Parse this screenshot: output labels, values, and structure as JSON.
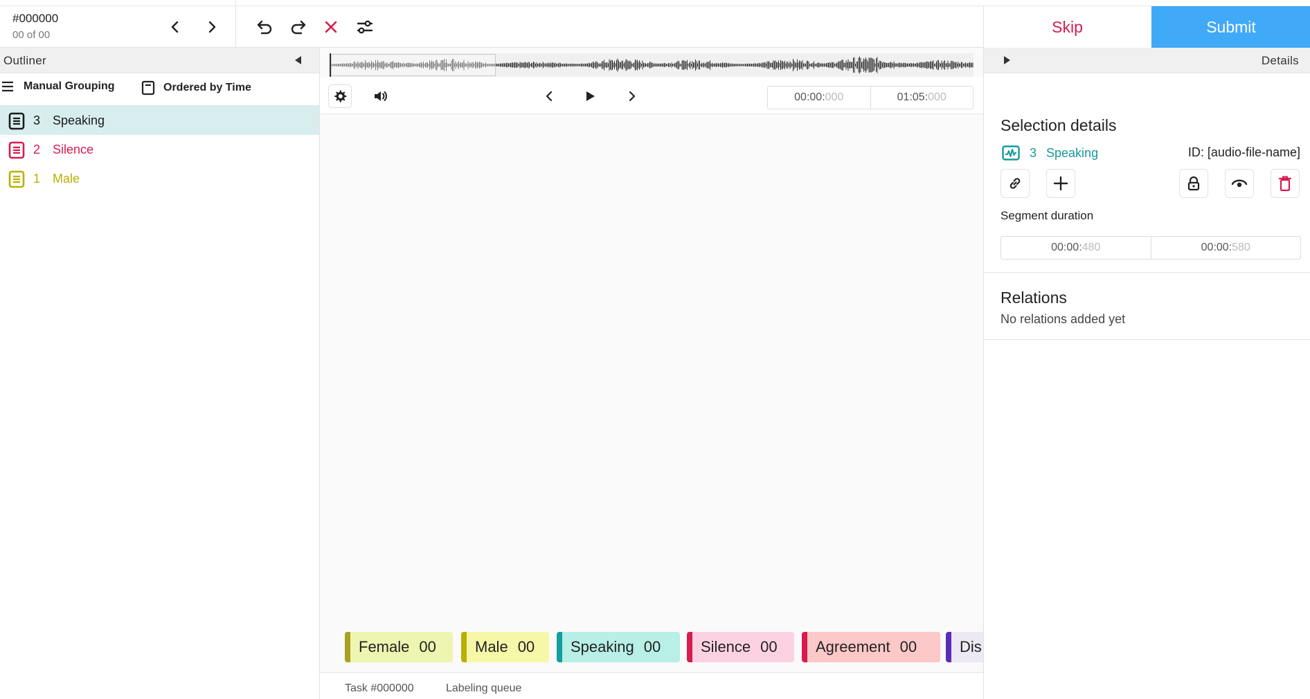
{
  "header": {
    "task_id": "#000000",
    "task_count": "00 of 00",
    "icons": [
      "chevron-left-icon",
      "chevron-right-icon",
      "undo-icon",
      "redo-icon",
      "close-icon",
      "settings-sliders-icon"
    ]
  },
  "actions": {
    "skip_label": "Skip",
    "submit_label": "Submit"
  },
  "outliner": {
    "title": "Outliner",
    "grouping_label": "Manual Grouping",
    "ordering_label": "Ordered by Time",
    "regions": [
      {
        "number": "3",
        "label": "Speaking",
        "color": "#1a1a1a",
        "selected": true
      },
      {
        "number": "2",
        "label": "Silence",
        "color": "#d81b4f",
        "selected": false
      },
      {
        "number": "1",
        "label": "Male",
        "color": "#b8b000",
        "selected": false
      }
    ]
  },
  "player": {
    "current_time_main": "00:00:",
    "current_time_ms": "000",
    "duration_main": "01:05:",
    "duration_ms": "000"
  },
  "labels": [
    {
      "name": "Female",
      "count": "00",
      "bg": "#eef5b0",
      "bar": "#a8a020"
    },
    {
      "name": "Male",
      "count": "00",
      "bg": "#f7f7a8",
      "bar": "#b8b000"
    },
    {
      "name": "Speaking",
      "count": "00",
      "bg": "#b8efe6",
      "bar": "#159e9e"
    },
    {
      "name": "Silence",
      "count": "00",
      "bg": "#fcd2e2",
      "bar": "#d81b4f"
    },
    {
      "name": "Agreement",
      "count": "00",
      "bg": "#fcc8c8",
      "bar": "#d81b4f"
    },
    {
      "name": "Dis",
      "count": "",
      "bg": "#ece8f4",
      "bar": "#5a2db8"
    }
  ],
  "footer": {
    "task": "Task #000000",
    "queue": "Labeling queue"
  },
  "details": {
    "title": "Details",
    "selection_title": "Selection details",
    "region_number": "3",
    "region_label": "Speaking",
    "region_id": "ID: [audio-file-name]",
    "segment_duration_label": "Segment duration",
    "seg_start_main": "00:00:",
    "seg_start_ms": "480",
    "seg_end_main": "00:00:",
    "seg_end_ms": "580",
    "relations_title": "Relations",
    "relations_empty": "No relations added yet"
  }
}
